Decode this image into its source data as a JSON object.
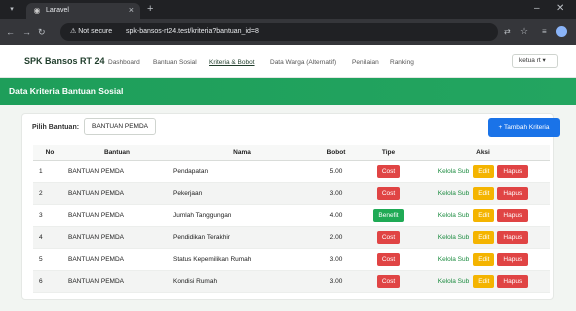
{
  "browser": {
    "tab_title": "Laravel",
    "tab_close": "×",
    "new_tab": "+",
    "security_label": "Not secure",
    "url": "spk-bansos-rt24.test/kriteria?bantuan_id=8",
    "icons": [
      "tab-menu-icon",
      "laravel-icon",
      "back-icon",
      "forward-icon",
      "reload-icon",
      "warning-icon",
      "translate-icon",
      "star-icon",
      "extensions-icon",
      "profile-avatar",
      "minimize-icon",
      "close-icon"
    ]
  },
  "navbar": {
    "brand": "SPK Bansos RT 24",
    "links": [
      "Dashboard",
      "Bantuan Sosial",
      "Kriteria & Bobot",
      "Data Warga (Alternatif)",
      "Penilaian",
      "Ranking"
    ],
    "active_link": "Kriteria & Bobot",
    "user": "ketua rt"
  },
  "header": {
    "title": "Data Kriteria Bantuan Sosial",
    "accent": "#1e9e5a"
  },
  "filter": {
    "label": "Pilih Bantuan:",
    "selected": "BANTUAN PEMDA"
  },
  "add_button": "+ Tambah Kriteria",
  "table": {
    "headers": [
      "No",
      "Bantuan",
      "Nama",
      "Bobot",
      "Tipe",
      "Aksi"
    ],
    "rows": [
      {
        "no": "1",
        "bantuan": "BANTUAN PEMDA",
        "nama": "Pendapatan",
        "bobot": "5.00",
        "tipe": "Cost"
      },
      {
        "no": "2",
        "bantuan": "BANTUAN PEMDA",
        "nama": "Pekerjaan",
        "bobot": "3.00",
        "tipe": "Cost"
      },
      {
        "no": "3",
        "bantuan": "BANTUAN PEMDA",
        "nama": "Jumlah Tanggungan",
        "bobot": "4.00",
        "tipe": "Benefit"
      },
      {
        "no": "4",
        "bantuan": "BANTUAN PEMDA",
        "nama": "Pendidikan Terakhir",
        "bobot": "2.00",
        "tipe": "Cost"
      },
      {
        "no": "5",
        "bantuan": "BANTUAN PEMDA",
        "nama": "Status Kepemilikan Rumah",
        "bobot": "3.00",
        "tipe": "Cost"
      },
      {
        "no": "6",
        "bantuan": "BANTUAN PEMDA",
        "nama": "Kondisi Rumah",
        "bobot": "3.00",
        "tipe": "Cost"
      }
    ],
    "actions": {
      "kelola": "Kelola Sub",
      "edit": "Edit",
      "hapus": "Hapus"
    }
  },
  "colors": {
    "cost": "#e04444",
    "benefit": "#1faa55",
    "edit": "#f4b400",
    "primary": "#1a73e8"
  }
}
